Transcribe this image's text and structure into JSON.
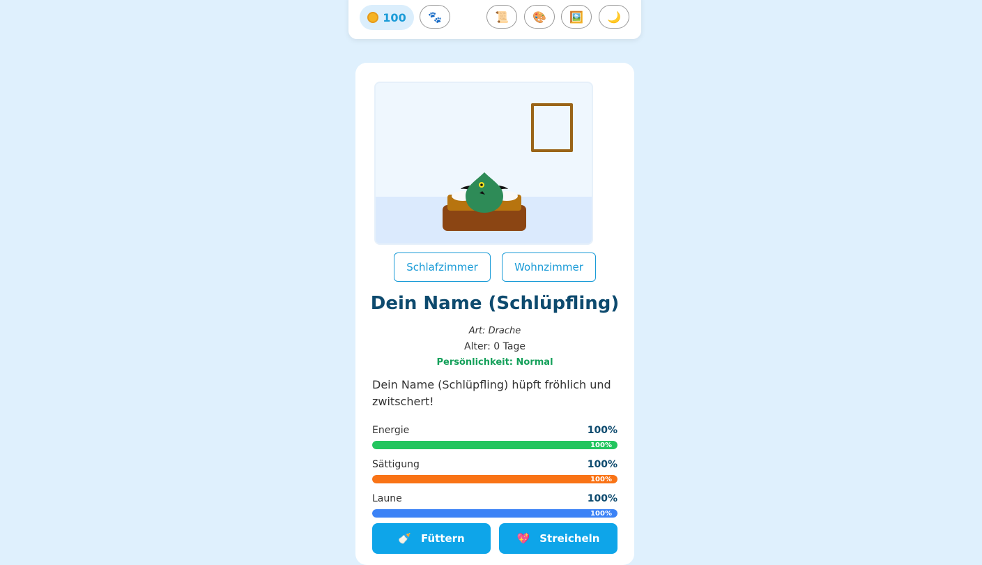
{
  "header": {
    "coins": "100",
    "coin_icon": "coin-icon",
    "buttons": [
      {
        "icon": "paw-icon",
        "glyph": "🐾"
      },
      {
        "icon": "scroll-icon",
        "glyph": "📜"
      },
      {
        "icon": "palette-icon",
        "glyph": "🎨"
      },
      {
        "icon": "picture-icon",
        "glyph": "🖼️"
      },
      {
        "icon": "moon-icon",
        "glyph": "🌙"
      }
    ]
  },
  "rooms": {
    "bedroom_label": "Schlafzimmer",
    "living_room_label": "Wohnzimmer"
  },
  "pet": {
    "name": "Dein Name (Schlüpfling)",
    "species": "Art: Drache",
    "age": "Alter: 0 Tage",
    "personality": "Persönlichkeit: Normal",
    "message": "Dein Name (Schlüpfling) hüpft fröhlich und zwitschert!"
  },
  "stats": [
    {
      "label": "Energie",
      "value": "100%",
      "level": 100,
      "color": "#22c55e"
    },
    {
      "label": "Sättigung",
      "value": "100%",
      "level": 100,
      "color": "#f97316"
    },
    {
      "label": "Laune",
      "value": "100%",
      "level": 100,
      "color": "#3b82f6"
    }
  ],
  "actions": {
    "feed_label": "Füttern",
    "feed_icon": "bottle-icon",
    "feed_glyph": "🍼",
    "pet_label": "Streicheln",
    "pet_icon": "heart-icon",
    "pet_glyph": "💖"
  },
  "colors": {
    "accent": "#1a9bd7",
    "title": "#0d4a6e",
    "dragon": "#2e8b57",
    "bed": "#8b4513"
  }
}
